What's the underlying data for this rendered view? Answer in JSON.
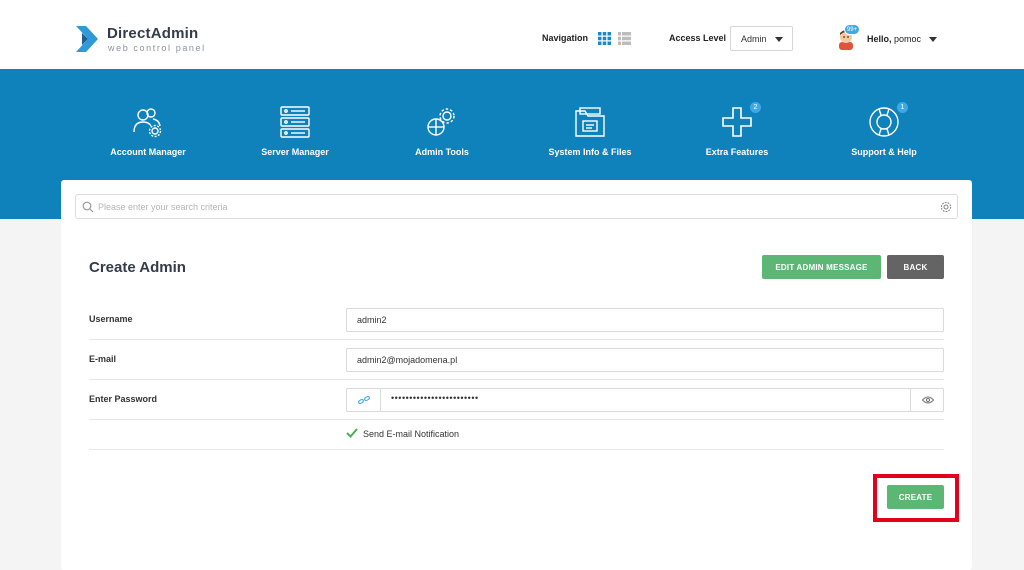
{
  "header": {
    "logo_title": "DirectAdmin",
    "logo_subtitle": "web control panel",
    "navigation_label": "Navigation",
    "access_level_label": "Access Level",
    "access_level_value": "Admin",
    "user_badge": "99+",
    "hello_text": "Hello,",
    "username": "pomoc"
  },
  "menu": [
    {
      "label": "Account Manager",
      "icon": "users-gear-icon"
    },
    {
      "label": "Server Manager",
      "icon": "server-icon"
    },
    {
      "label": "Admin Tools",
      "icon": "tools-icon"
    },
    {
      "label": "System Info & Files",
      "icon": "folder-icon"
    },
    {
      "label": "Extra Features",
      "icon": "plus-icon",
      "badge": "2"
    },
    {
      "label": "Support & Help",
      "icon": "lifebuoy-icon",
      "badge": "1"
    }
  ],
  "search": {
    "placeholder": "Please enter your search criteria"
  },
  "page": {
    "title": "Create Admin",
    "edit_message_label": "EDIT ADMIN MESSAGE",
    "back_label": "BACK",
    "create_label": "CREATE"
  },
  "form": {
    "username_label": "Username",
    "username_value": "admin2",
    "email_label": "E-mail",
    "email_value": "admin2@mojadomena.pl",
    "password_label": "Enter Password",
    "password_masked": "••••••••••••••••••••••••",
    "notification_label": "Send E-mail Notification",
    "notification_checked": true
  },
  "colors": {
    "brand_blue": "#0f82bb",
    "button_green": "#5cb774",
    "button_gray": "#646464",
    "highlight_red": "#e2001a",
    "badge_blue": "#3fa9e8"
  }
}
